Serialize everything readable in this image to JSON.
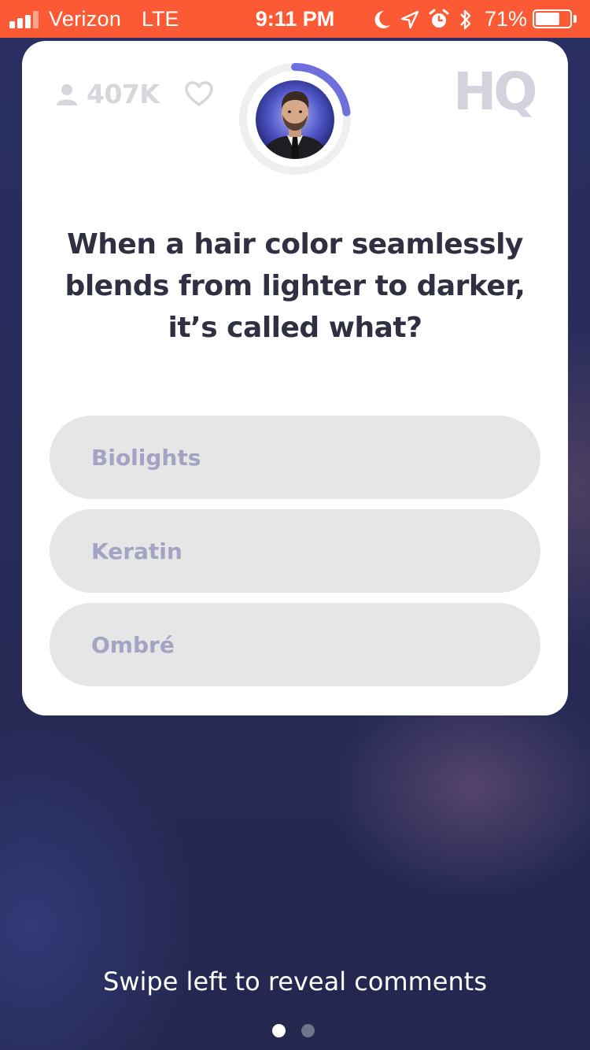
{
  "status_bar": {
    "carrier": "Verizon",
    "network": "LTE",
    "time": "9:11 PM",
    "battery_percent": "71%",
    "battery_level": 0.71,
    "signal_bars": 3,
    "icons": [
      "moon-icon",
      "location-arrow-icon",
      "alarm-icon",
      "bluetooth-icon"
    ],
    "background_color": "#fc5a34"
  },
  "game": {
    "viewers": "407K",
    "logo": "HQ",
    "timer_accent": "#6d6fdc",
    "timer_progress": 0.23,
    "question": "When a hair color seamlessly blends from lighter to darker, it’s called what?",
    "answers": [
      {
        "label": "Biolights"
      },
      {
        "label": "Keratin"
      },
      {
        "label": "Ombré"
      }
    ]
  },
  "footer": {
    "hint": "Swipe left to reveal comments",
    "page_count": 2,
    "active_page": 1
  }
}
